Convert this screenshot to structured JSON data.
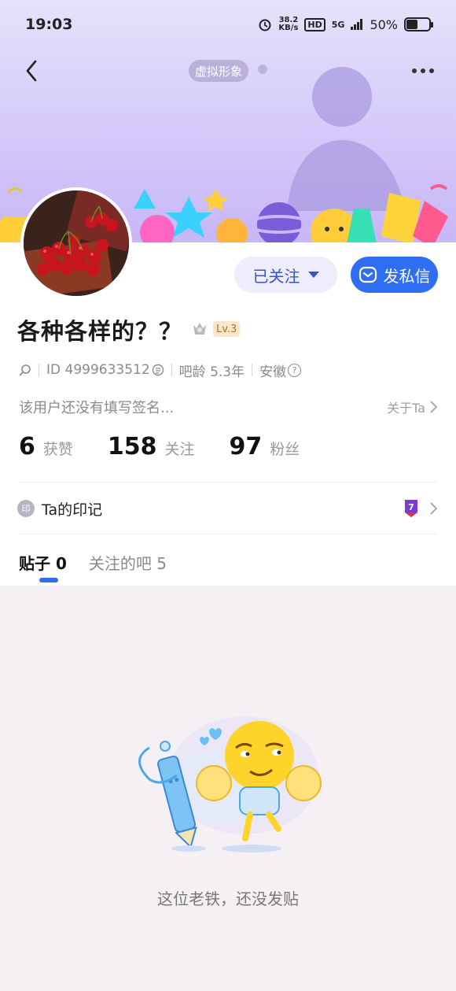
{
  "status_bar": {
    "time": "19:03",
    "net_speed_value": "38.2",
    "net_speed_unit": "KB/s",
    "hd_label": "HD",
    "network_label": "5G",
    "battery_percent": "50%",
    "battery_level": 0.5
  },
  "header": {
    "virtual_avatar_label": "虚拟形象"
  },
  "profile": {
    "username": "各种各样的？？",
    "level": "Lv.3",
    "id_text": "ID 4999633512",
    "account_age": "吧龄 5.3年",
    "location": "安徽",
    "signature": "该用户还没有填写签名...",
    "about_label": "关于Ta"
  },
  "actions": {
    "follow_label": "已关注",
    "message_label": "发私信"
  },
  "stats": [
    {
      "value": "6",
      "label": "获赞"
    },
    {
      "value": "158",
      "label": "关注"
    },
    {
      "value": "97",
      "label": "粉丝"
    }
  ],
  "imprint": {
    "badge": "印",
    "label": "Ta的印记",
    "medal_number": "7"
  },
  "tabs": [
    {
      "label": "贴子 0",
      "active": true
    },
    {
      "label": "关注的吧 5",
      "active": false
    }
  ],
  "empty_state": {
    "message": "这位老铁，还没发贴"
  },
  "colors": {
    "accent": "#2f6ef2",
    "follow_text": "#3755c9",
    "banner_top": "#e6e2fb",
    "banner_bottom": "#c6b5f6"
  }
}
